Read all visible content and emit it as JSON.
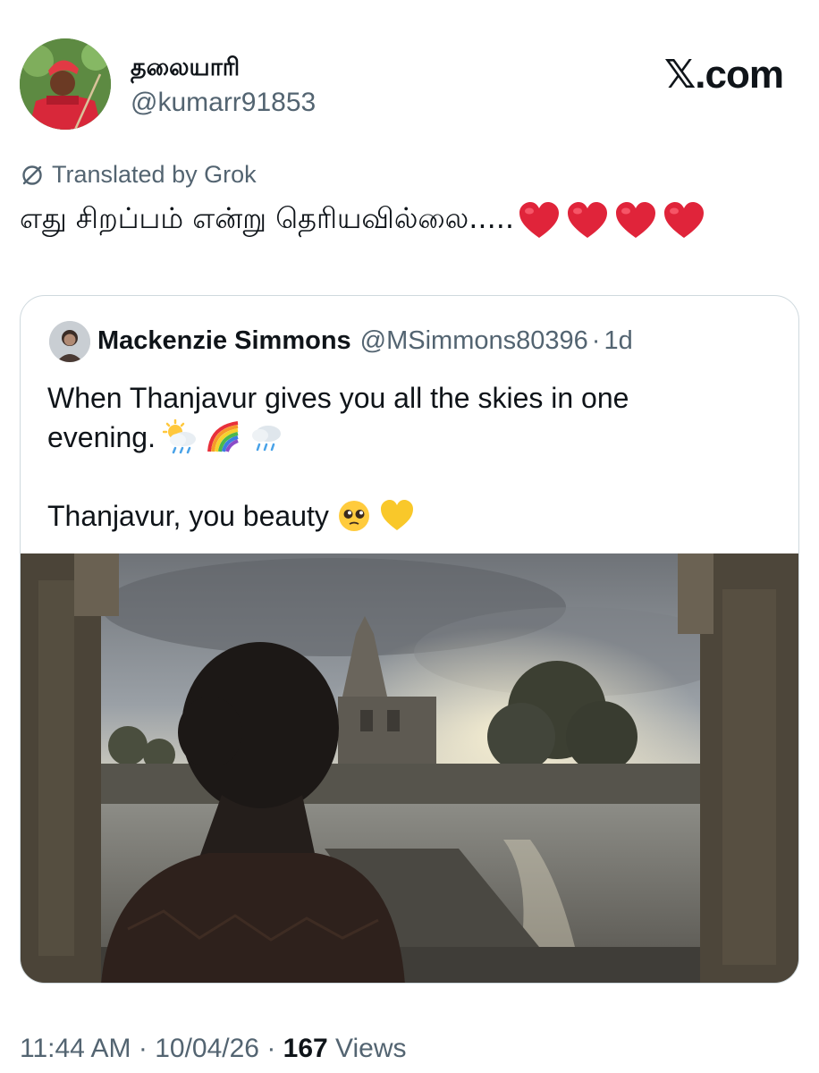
{
  "author": {
    "display_name": "தலையாரி",
    "handle": "@kumarr91853"
  },
  "brand": "𝕏.com",
  "translation": {
    "label": "Translated by Grok",
    "icon": "translate-slash-icon"
  },
  "tweet": {
    "text": "எது சிறப்பம் என்று தெரியவில்லை.....",
    "emojis": [
      "red-heart",
      "red-heart",
      "red-heart",
      "red-heart"
    ]
  },
  "quote": {
    "display_name": "Mackenzie Simmons",
    "handle": "@MSimmons80396",
    "separator": "·",
    "time": "1d",
    "line1": "When Thanjavur gives you all the skies in one",
    "line2": "evening.",
    "line2_emojis": [
      "sun-behind-rain-cloud",
      "rainbow",
      "cloud-with-rain"
    ],
    "line3": "Thanjavur, you beauty",
    "line3_emojis": [
      "pleading-face",
      "yellow-heart"
    ],
    "photo_alt_icon": "temple-photo"
  },
  "footer": {
    "time": "11:44 AM",
    "sep1": " · ",
    "date": "10/04/26",
    "sep2": " · ",
    "views_count": "167",
    "views_label": " Views"
  },
  "colors": {
    "text": "#0f1419",
    "secondary": "#536471",
    "border": "#cfd9de",
    "heart": "#e0243a"
  }
}
